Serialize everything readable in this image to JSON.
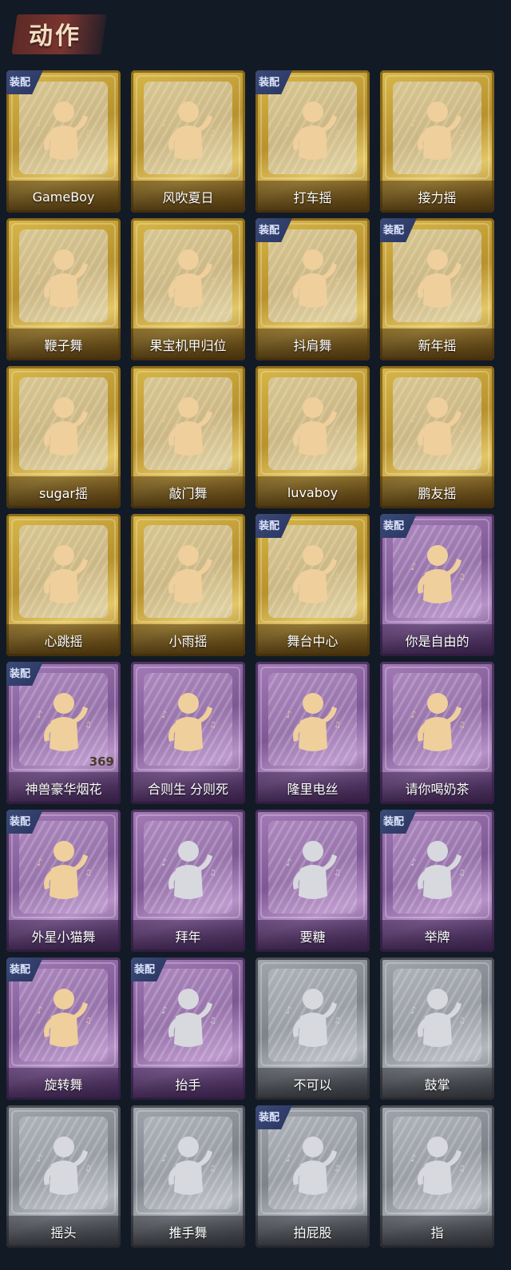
{
  "header": {
    "title": "动作"
  },
  "badge_text": "装配",
  "colors": {
    "gold": "#c9a63c",
    "purple": "#8c66a4",
    "silver": "#8e9299",
    "figure_gold": "#efcf9c",
    "figure_silver": "#d7d9de"
  },
  "cards": [
    {
      "label": "GameBoy",
      "tier": "gold",
      "equipped": true
    },
    {
      "label": "风吹夏日",
      "tier": "gold",
      "equipped": false
    },
    {
      "label": "打车摇",
      "tier": "gold",
      "equipped": true
    },
    {
      "label": "接力摇",
      "tier": "gold",
      "equipped": false
    },
    {
      "label": "鞭子舞",
      "tier": "gold",
      "equipped": false
    },
    {
      "label": "果宝机甲归位",
      "tier": "gold",
      "equipped": false
    },
    {
      "label": "抖肩舞",
      "tier": "gold",
      "equipped": true
    },
    {
      "label": "新年摇",
      "tier": "gold",
      "equipped": true
    },
    {
      "label": "sugar摇",
      "tier": "gold",
      "equipped": false
    },
    {
      "label": "敲门舞",
      "tier": "gold",
      "equipped": false
    },
    {
      "label": "luvaboy",
      "tier": "gold",
      "equipped": false
    },
    {
      "label": "鹏友摇",
      "tier": "gold",
      "equipped": false
    },
    {
      "label": "心跳摇",
      "tier": "gold",
      "equipped": false
    },
    {
      "label": "小雨摇",
      "tier": "gold",
      "equipped": false
    },
    {
      "label": "舞台中心",
      "tier": "gold",
      "equipped": true
    },
    {
      "label": "你是自由的",
      "tier": "purple",
      "equipped": true
    },
    {
      "label": "神兽豪华烟花",
      "tier": "purple",
      "equipped": true,
      "count": "369"
    },
    {
      "label": "合则生 分则死",
      "tier": "purple",
      "equipped": false
    },
    {
      "label": "隆里电丝",
      "tier": "purple",
      "equipped": false
    },
    {
      "label": "请你喝奶茶",
      "tier": "purple",
      "equipped": false
    },
    {
      "label": "外星小猫舞",
      "tier": "purple",
      "equipped": true
    },
    {
      "label": "拜年",
      "tier": "purple",
      "equipped": false,
      "figure": "silver"
    },
    {
      "label": "要糖",
      "tier": "purple",
      "equipped": false,
      "figure": "silver"
    },
    {
      "label": "举牌",
      "tier": "purple",
      "equipped": true,
      "figure": "silver"
    },
    {
      "label": "旋转舞",
      "tier": "purple",
      "equipped": true
    },
    {
      "label": "抬手",
      "tier": "purple",
      "equipped": true,
      "figure": "silver"
    },
    {
      "label": "不可以",
      "tier": "silver",
      "equipped": false
    },
    {
      "label": "鼓掌",
      "tier": "silver",
      "equipped": false
    },
    {
      "label": "摇头",
      "tier": "silver",
      "equipped": false
    },
    {
      "label": "推手舞",
      "tier": "silver",
      "equipped": false
    },
    {
      "label": "拍屁股",
      "tier": "silver",
      "equipped": true
    },
    {
      "label": "指",
      "tier": "silver",
      "equipped": false
    }
  ]
}
